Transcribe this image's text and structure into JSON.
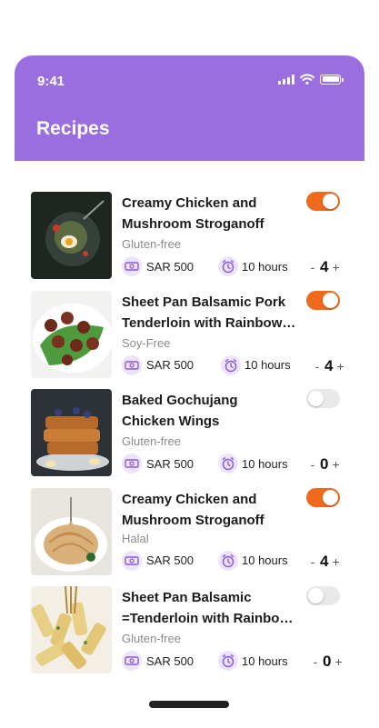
{
  "status_bar": {
    "time": "9:41"
  },
  "header": {
    "title": "Recipes"
  },
  "recipes": [
    {
      "title_line1": "Creamy Chicken and",
      "title_line2": "Mushroom Stroganoff",
      "tag": "Gluten-free",
      "price": "SAR 500",
      "time": "10 hours",
      "enabled": true,
      "quantity": "4",
      "minus": "-",
      "plus": "+"
    },
    {
      "title_line1": "Sheet Pan Balsamic Pork",
      "title_line2": "Tenderloin with Rainbow…",
      "tag": "Soy-Free",
      "price": "SAR 500",
      "time": "10 hours",
      "enabled": true,
      "quantity": "4",
      "minus": "-",
      "plus": "+"
    },
    {
      "title_line1": "Baked Gochujang",
      "title_line2": "Chicken Wings",
      "tag": "Gluten-free",
      "price": "SAR 500",
      "time": "10 hours",
      "enabled": false,
      "quantity": "0",
      "minus": "-",
      "plus": "+"
    },
    {
      "title_line1": "Creamy Chicken and",
      "title_line2": "Mushroom Stroganoff",
      "tag": "Halal",
      "price": "SAR 500",
      "time": "10 hours",
      "enabled": true,
      "quantity": "4",
      "minus": "-",
      "plus": "+"
    },
    {
      "title_line1": "Sheet Pan Balsamic",
      "title_line2": "=Tenderloin with Rainbow…",
      "tag": "Gluten-free",
      "price": "SAR 500",
      "time": "10 hours",
      "enabled": false,
      "quantity": "0",
      "minus": "-",
      "plus": "+"
    }
  ],
  "colors": {
    "header": "#9b6ee0",
    "toggle_on": "#ef6a1c",
    "toggle_off": "#e9e9ec",
    "icon_bg": "#ede4fb",
    "icon": "#8b5cd6"
  },
  "icons": {
    "price": "banknote-icon",
    "time": "alarm-clock-icon"
  }
}
